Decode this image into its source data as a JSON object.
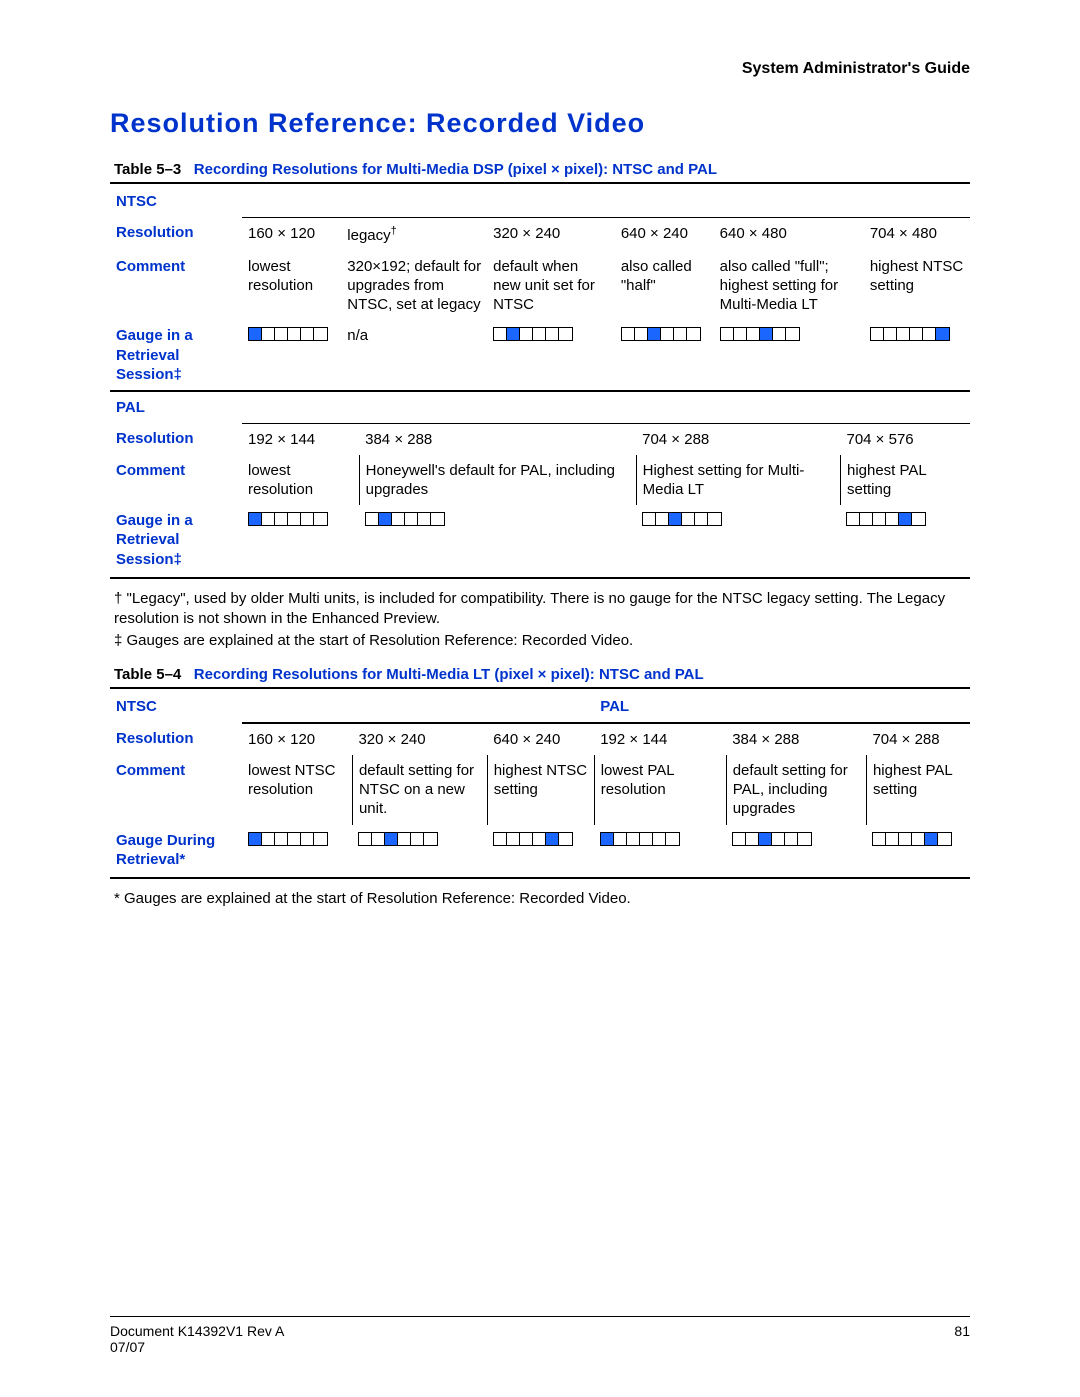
{
  "header": {
    "guide_title": "System Administrator's Guide"
  },
  "section_title": "Resolution Reference: Recorded Video",
  "table53": {
    "caption_left": "Table 5–3",
    "caption_main": "Recording Resolutions for Multi-Media DSP (pixel × pixel): NTSC and PAL",
    "ntsc_label": "NTSC",
    "resolution_label": "Resolution",
    "comment_label": "Comment",
    "gauge_label": "Gauge in a Retrieval Session‡",
    "ntsc_resolutions": [
      "160 × 120",
      "legacy",
      "320 × 240",
      "640 × 240",
      "640 × 480",
      "704 × 480"
    ],
    "ntsc_legacy_dagger": "†",
    "ntsc_comments": [
      "lowest resolution",
      "320×192; default for upgrades from NTSC, set at legacy",
      "default when new unit set for NTSC",
      "also called \"half\"",
      "also called \"full\"; highest setting for Multi-Media LT",
      "highest NTSC setting"
    ],
    "ntsc_gauges": [
      1,
      "n/a",
      2,
      3,
      4,
      6
    ],
    "pal_label": "PAL",
    "pal_resolutions": [
      "192 × 144",
      "384 × 288",
      "704 × 288",
      "704 × 576"
    ],
    "pal_comments": [
      "lowest resolution",
      "Honeywell's default for PAL, including upgrades",
      "Highest setting for Multi-Media LT",
      "highest PAL setting"
    ],
    "pal_gauges": [
      1,
      2,
      3,
      5
    ],
    "footnote_dagger": "† \"Legacy\", used by older Multi units, is included for compatibility. There is no gauge for the NTSC legacy setting. The Legacy resolution is not shown in the Enhanced Preview.",
    "footnote_ddagger": "‡ Gauges are explained at the start of Resolution Reference: Recorded Video."
  },
  "table54": {
    "caption_left": "Table 5–4",
    "caption_main": "Recording Resolutions for Multi-Media LT (pixel × pixel): NTSC and PAL",
    "ntsc_label": "NTSC",
    "pal_label": "PAL",
    "resolution_label": "Resolution",
    "comment_label": "Comment",
    "gauge_label": "Gauge During Retrieval*",
    "resolutions": [
      "160 × 120",
      "320 × 240",
      "640 × 240",
      "192 × 144",
      "384 × 288",
      "704 × 288"
    ],
    "comments": [
      "lowest NTSC resolution",
      "default setting for NTSC on a new unit.",
      "highest NTSC setting",
      "lowest PAL resolution",
      "default setting for PAL, including upgrades",
      "highest PAL setting"
    ],
    "gauges": [
      1,
      3,
      5,
      1,
      3,
      5
    ],
    "footnote_star": "* Gauges are explained at the start of Resolution Reference: Recorded Video."
  },
  "footer": {
    "doc_id": "Document K14392V1 Rev A",
    "date": "07/07",
    "page": "81"
  },
  "chart_data": [
    {
      "type": "table",
      "title": "Table 5–3 Recording Resolutions for Multi-Media DSP (pixel × pixel): NTSC and PAL",
      "ntsc": {
        "columns": [
          "160 × 120",
          "legacy†",
          "320 × 240",
          "640 × 240",
          "640 × 480",
          "704 × 480"
        ],
        "comments": [
          "lowest resolution",
          "320×192; default for upgrades from NTSC, set at legacy",
          "default when new unit set for NTSC",
          "also called \"half\"",
          "also called \"full\"; highest setting for Multi-Media LT",
          "highest NTSC setting"
        ],
        "gauge_filled_of_6": [
          1,
          null,
          2,
          3,
          4,
          6
        ]
      },
      "pal": {
        "columns": [
          "192 × 144",
          "384 × 288",
          "704 × 288",
          "704 × 576"
        ],
        "comments": [
          "lowest resolution",
          "Honeywell's default for PAL, including upgrades",
          "Highest setting for Multi-Media LT",
          "highest PAL setting"
        ],
        "gauge_filled_of_6": [
          1,
          2,
          3,
          5
        ]
      }
    },
    {
      "type": "table",
      "title": "Table 5–4 Recording Resolutions for Multi-Media LT (pixel × pixel): NTSC and PAL",
      "ntsc": {
        "columns": [
          "160 × 120",
          "320 × 240",
          "640 × 240"
        ],
        "comments": [
          "lowest NTSC resolution",
          "default setting for NTSC on a new unit.",
          "highest NTSC setting"
        ],
        "gauge_filled_of_6": [
          1,
          3,
          5
        ]
      },
      "pal": {
        "columns": [
          "192 × 144",
          "384 × 288",
          "704 × 288"
        ],
        "comments": [
          "lowest PAL resolution",
          "default setting for PAL, including upgrades",
          "highest PAL setting"
        ],
        "gauge_filled_of_6": [
          1,
          3,
          5
        ]
      }
    }
  ]
}
